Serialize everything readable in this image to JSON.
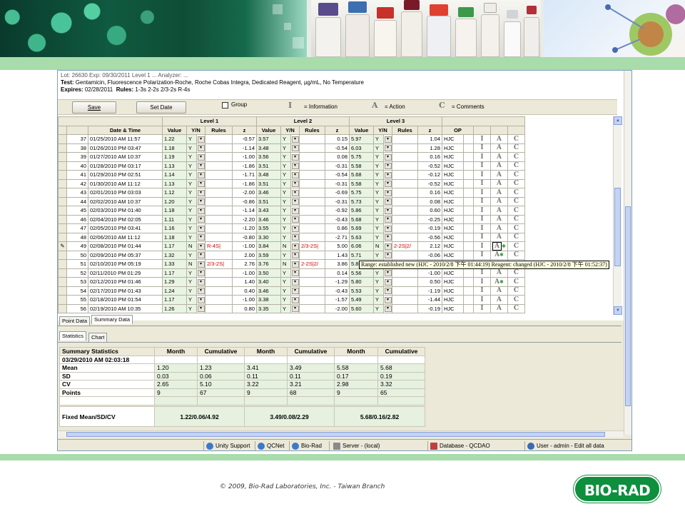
{
  "header": {
    "info_truncated": "Lot: 26630 Exp: 09/30/2011  Level 1 ... Analyzer: ...",
    "test_label": "Test:",
    "test_value": "Gentamicin, Fluorescence Polarization-Roche, Roche Cobas Integra, Dedicated Reagent, µg/mL, No Temperature",
    "expires_label": "Expires:",
    "expires_value": "02/28/2011",
    "rules_label": "Rules:",
    "rules_value": "1-3s 2-2s 2/3-2s R-4s"
  },
  "toolbar": {
    "save_label": "Save",
    "set_date_label": "Set Date",
    "group_label": "Group",
    "info_glyph": "I",
    "info_label": "= Information",
    "action_glyph": "A",
    "action_label": "= Action",
    "comments_glyph": "C",
    "comments_label": "= Comments"
  },
  "grid": {
    "level_headers": [
      "Level 1",
      "Level 2",
      "Level 3"
    ],
    "col_datetime": "Date & Time",
    "col_value": "Value",
    "col_yn": "Y/N",
    "col_rules": "Rules",
    "col_z": "z",
    "col_op": "OP",
    "rows": [
      {
        "n": "37",
        "dt": "01/25/2010 AM 11:57",
        "v1": "1.22",
        "y1": "Y",
        "r1": "",
        "z1": "-0.57",
        "v2": "3.57",
        "y2": "Y",
        "r2": "",
        "z2": "0.15",
        "v3": "5.97",
        "y3": "Y",
        "r3": "",
        "z3": "1.04",
        "op": "HJC",
        "i": "I",
        "a": "A",
        "c": "C"
      },
      {
        "n": "38",
        "dt": "01/26/2010 PM 03:47",
        "v1": "1.18",
        "y1": "Y",
        "r1": "",
        "z1": "-1.14",
        "v2": "3.48",
        "y2": "Y",
        "r2": "",
        "z2": "-0.54",
        "v3": "6.03",
        "y3": "Y",
        "r3": "",
        "z3": "1.28",
        "op": "HJC",
        "i": "I",
        "a": "A",
        "c": "C"
      },
      {
        "n": "39",
        "dt": "01/27/2010 AM 10:37",
        "v1": "1.19",
        "y1": "Y",
        "r1": "",
        "z1": "-1.00",
        "v2": "3.56",
        "y2": "Y",
        "r2": "",
        "z2": "0.08",
        "v3": "5.75",
        "y3": "Y",
        "r3": "",
        "z3": "0.16",
        "op": "HJC",
        "i": "I",
        "a": "A",
        "c": "C"
      },
      {
        "n": "40",
        "dt": "01/28/2010 PM 03:17",
        "v1": "1.13",
        "y1": "Y",
        "r1": "",
        "z1": "-1.86",
        "v2": "3.51",
        "y2": "Y",
        "r2": "",
        "z2": "-0.31",
        "v3": "5.58",
        "y3": "Y",
        "r3": "",
        "z3": "-0.52",
        "op": "HJC",
        "i": "I",
        "a": "A",
        "c": "C"
      },
      {
        "n": "41",
        "dt": "01/29/2010 PM 02:51",
        "v1": "1.14",
        "y1": "Y",
        "r1": "",
        "z1": "-1.71",
        "v2": "3.48",
        "y2": "Y",
        "r2": "",
        "z2": "-0.54",
        "v3": "5.68",
        "y3": "Y",
        "r3": "",
        "z3": "-0.12",
        "op": "HJC",
        "i": "I",
        "a": "A",
        "c": "C"
      },
      {
        "n": "42",
        "dt": "01/30/2010 AM 11:12",
        "v1": "1.13",
        "y1": "Y",
        "r1": "",
        "z1": "-1.86",
        "v2": "3.51",
        "y2": "Y",
        "r2": "",
        "z2": "-0.31",
        "v3": "5.58",
        "y3": "Y",
        "r3": "",
        "z3": "-0.52",
        "op": "HJC",
        "i": "I",
        "a": "A",
        "c": "C"
      },
      {
        "n": "43",
        "dt": "02/01/2010 PM 03:03",
        "v1": "1.12",
        "y1": "Y",
        "r1": "",
        "z1": "-2.00",
        "v2": "3.46",
        "y2": "Y",
        "r2": "",
        "z2": "-0.69",
        "v3": "5.75",
        "y3": "Y",
        "r3": "",
        "z3": "0.16",
        "op": "HJC",
        "i": "I",
        "a": "A",
        "c": "C"
      },
      {
        "n": "44",
        "dt": "02/02/2010 AM 10:37",
        "v1": "1.20",
        "y1": "Y",
        "r1": "",
        "z1": "-0.86",
        "v2": "3.51",
        "y2": "Y",
        "r2": "",
        "z2": "-0.31",
        "v3": "5.73",
        "y3": "Y",
        "r3": "",
        "z3": "0.08",
        "op": "HJC",
        "i": "I",
        "a": "A",
        "c": "C"
      },
      {
        "n": "45",
        "dt": "02/03/2010 PM 01:40",
        "v1": "1.18",
        "y1": "Y",
        "r1": "",
        "z1": "-1.14",
        "v2": "3.43",
        "y2": "Y",
        "r2": "",
        "z2": "-0.92",
        "v3": "5.86",
        "y3": "Y",
        "r3": "",
        "z3": "0.60",
        "op": "HJC",
        "i": "I",
        "a": "A",
        "c": "C"
      },
      {
        "n": "46",
        "dt": "02/04/2010 PM 02:05",
        "v1": "1.11",
        "y1": "Y",
        "r1": "",
        "z1": "-2.20",
        "v2": "3.46",
        "y2": "Y",
        "r2": "",
        "z2": "-0.43",
        "v3": "5.68",
        "y3": "Y",
        "r3": "",
        "z3": "-0.25",
        "op": "HJC",
        "i": "I",
        "a": "A",
        "c": "C"
      },
      {
        "n": "47",
        "dt": "02/05/2010 PM 03:41",
        "v1": "1.16",
        "y1": "Y",
        "r1": "",
        "z1": "-1.20",
        "v2": "3.55",
        "y2": "Y",
        "r2": "",
        "z2": "0.86",
        "v3": "5.69",
        "y3": "Y",
        "r3": "",
        "z3": "-0.19",
        "op": "HJC",
        "i": "I",
        "a": "A",
        "c": "C"
      },
      {
        "n": "48",
        "dt": "02/06/2010 AM 11:12",
        "v1": "1.18",
        "y1": "Y",
        "r1": "",
        "z1": "-0.80",
        "v2": "3.30",
        "y2": "Y",
        "r2": "",
        "z2": "-2.71",
        "v3": "5.63",
        "y3": "Y",
        "r3": "",
        "z3": "-0.56",
        "op": "HJC",
        "i": "I",
        "a": "A",
        "c": "C"
      },
      {
        "n": "49",
        "dt": "02/08/2010 PM 01:44",
        "v1": "1.17",
        "y1": "N",
        "r1": "R-4S|",
        "z1": "-1.00",
        "v2": "3.84",
        "y2": "N",
        "r2": "2/3-2S|",
        "z2": "5.00",
        "v3": "6.06",
        "y3": "N",
        "r3": "2-2S|2/",
        "z3": "2.12",
        "op": "HJC",
        "i": "I",
        "a": "A",
        "c": "C",
        "star": true,
        "box": true
      },
      {
        "n": "50",
        "dt": "02/09/2010 PM 05:37",
        "v1": "1.32",
        "y1": "Y",
        "r1": "",
        "z1": "2.00",
        "v2": "3.59",
        "y2": "Y",
        "r2": "",
        "z2": "1.43",
        "v3": "5.71",
        "y3": "Y",
        "r3": "",
        "z3": "-0.06",
        "op": "HJC",
        "i": "I",
        "a": "A",
        "c": "C",
        "star": true
      },
      {
        "n": "51",
        "dt": "02/10/2010 PM 05:19",
        "v1": "1.33",
        "y1": "N",
        "r1": "2/3-2S|",
        "z1": "2.76",
        "v2": "3.76",
        "y2": "N",
        "r2": "2-2S|2/",
        "z2": "3.86",
        "v3": "5.85",
        "y3": "",
        "r3": "",
        "z3": "",
        "op": "",
        "i": "",
        "a": "",
        "c": ""
      },
      {
        "n": "52",
        "dt": "02/11/2010 PM 01:29",
        "v1": "1.17",
        "y1": "Y",
        "r1": "",
        "z1": "-1.00",
        "v2": "3.50",
        "y2": "Y",
        "r2": "",
        "z2": "0.14",
        "v3": "5.56",
        "y3": "Y",
        "r3": "",
        "z3": "-1.00",
        "op": "HJC",
        "i": "I",
        "a": "A",
        "c": "C"
      },
      {
        "n": "53",
        "dt": "02/12/2010 PM 01:46",
        "v1": "1.29",
        "y1": "Y",
        "r1": "",
        "z1": "1.40",
        "v2": "3.40",
        "y2": "Y",
        "r2": "",
        "z2": "-1.29",
        "v3": "5.80",
        "y3": "Y",
        "r3": "",
        "z3": "0.50",
        "op": "HJC",
        "i": "I",
        "a": "A",
        "c": "C",
        "star": true
      },
      {
        "n": "54",
        "dt": "02/17/2010 PM 01:43",
        "v1": "1.24",
        "y1": "Y",
        "r1": "",
        "z1": "0.40",
        "v2": "3.46",
        "y2": "Y",
        "r2": "",
        "z2": "-0.43",
        "v3": "5.53",
        "y3": "Y",
        "r3": "",
        "z3": "-1.19",
        "op": "HJC",
        "i": "I",
        "a": "A",
        "c": "C"
      },
      {
        "n": "55",
        "dt": "02/18/2010 PM 01:54",
        "v1": "1.17",
        "y1": "Y",
        "r1": "",
        "z1": "-1.00",
        "v2": "3.38",
        "y2": "Y",
        "r2": "",
        "z2": "-1.57",
        "v3": "5.49",
        "y3": "Y",
        "r3": "",
        "z3": "-1.44",
        "op": "HJC",
        "i": "I",
        "a": "A",
        "c": "C"
      },
      {
        "n": "56",
        "dt": "02/19/2010 AM 10:35",
        "v1": "1.26",
        "y1": "Y",
        "r1": "",
        "z1": "0.80",
        "v2": "3.35",
        "y2": "Y",
        "r2": "",
        "z2": "-2.00",
        "v3": "5.60",
        "y3": "Y",
        "r3": "",
        "z3": "-0.19",
        "op": "HJC",
        "i": "I",
        "a": "A",
        "c": "C"
      }
    ],
    "tooltip": "Range: established new (HJC - 2010/2/8 下午 01:44:19) Reagent: changed (HJC - 2010/2/8 下午 01:52:37)"
  },
  "tabs": {
    "point_data": "Point Data",
    "summary_data": "Summary Data",
    "statistics": "Statistics",
    "chart": "Chart"
  },
  "summary": {
    "title": "Summary Statistics",
    "col_month": "Month",
    "col_cumulative": "Cumulative",
    "date": "03/29/2010 AM 02:03:18",
    "rows": [
      {
        "label": "Mean",
        "vals": [
          "1.20",
          "1.23",
          "3.41",
          "3.49",
          "5.58",
          "5.68"
        ]
      },
      {
        "label": "SD",
        "vals": [
          "0.03",
          "0.06",
          "0.11",
          "0.11",
          "0.17",
          "0.19"
        ]
      },
      {
        "label": "CV",
        "vals": [
          "2.65",
          "5.10",
          "3.22",
          "3.21",
          "2.98",
          "3.32"
        ]
      },
      {
        "label": "Points",
        "vals": [
          "9",
          "67",
          "9",
          "68",
          "9",
          "65"
        ]
      }
    ],
    "fixed_label": "Fixed Mean/SD/CV",
    "fixed_values": [
      "1.22/0.06/4.92",
      "3.49/0.08/2.29",
      "5.68/0.16/2.82"
    ]
  },
  "statusbar": {
    "unity_support": "Unity Support",
    "qcnet": "QCNet",
    "biorad": "Bio-Rad",
    "server": "Server - (local)",
    "database": "Database - QCDAO",
    "user": "User - admin - Edit all data"
  },
  "footer": {
    "copyright": "© 2009, Bio-Rad Laboratories, Inc. - Taiwan Branch",
    "logo_text": "BIO-RAD"
  },
  "colors": {
    "band_green": "#a8dcaa",
    "grid_green": "#e9f4e3",
    "rule_red": "#d00000",
    "logo_green": "#0e8f3e"
  }
}
